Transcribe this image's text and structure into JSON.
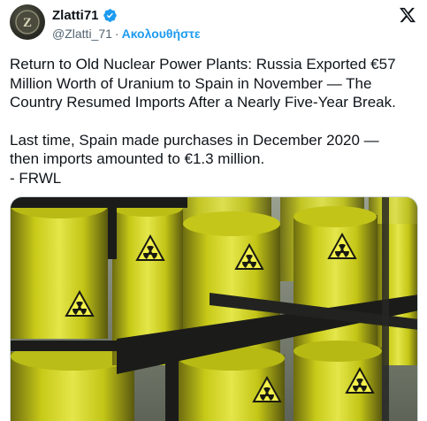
{
  "author": {
    "display_name": "Zlatti71",
    "handle": "@Zlatti_71",
    "separator": "·",
    "follow_label": "Ακολουθήστε",
    "avatar_letter": "Z",
    "verified_color": "#1d9bf0"
  },
  "tweet": {
    "paragraph1": "Return to Old Nuclear Power Plants: Russia Exported €57 Million Worth of Uranium to Spain in November — The Country Resumed Imports After a Nearly Five-Year Break.",
    "paragraph2": "Last time, Spain made purchases in December 2020 —\nthen imports amounted to €1.3 million.\n- FRWL"
  },
  "media": {
    "subject": "yellow barrels with radiation hazard symbols on black pallet racks",
    "colors": {
      "barrel": "#d6d81e",
      "shadow": "#6f6d12",
      "rack": "#1b1c1a",
      "wall": "#8e9486"
    }
  },
  "icons": {
    "verified": "verified-badge-icon",
    "x_logo": "x-logo-icon"
  }
}
